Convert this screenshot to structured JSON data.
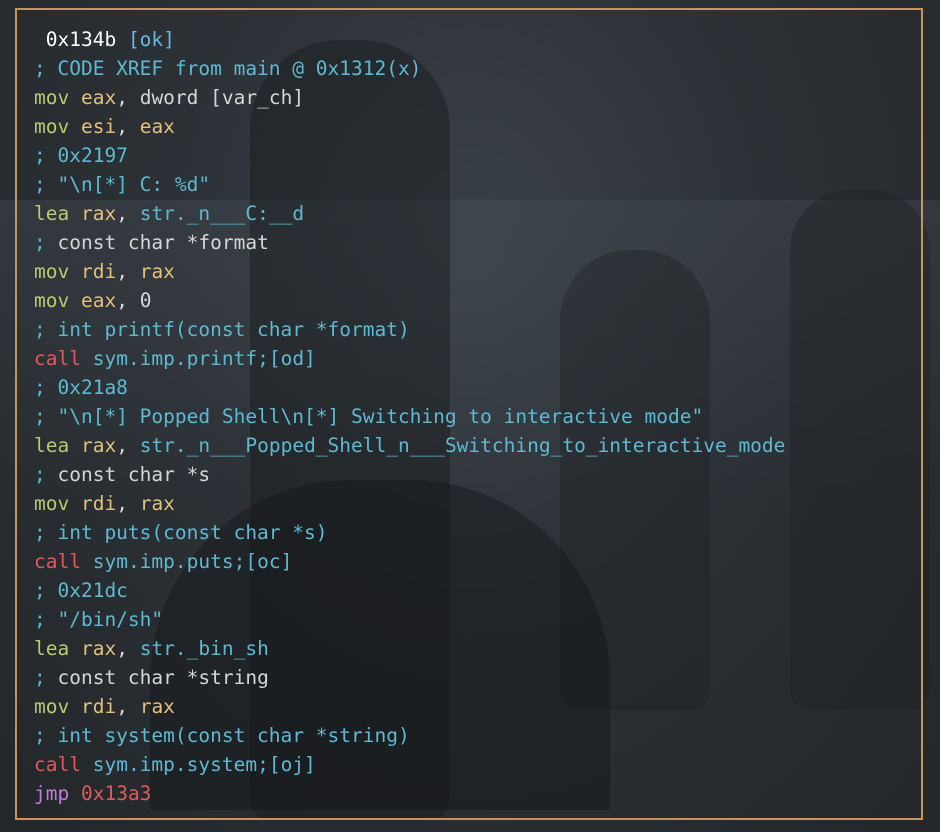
{
  "colors": {
    "border": "#c8935e",
    "comment": "#5dbad2",
    "mnemonic": "#b5cc6e",
    "register": "#e2c07a",
    "call": "#e05a5a",
    "jump": "#c678dd"
  },
  "header": {
    "address": " 0x134b",
    "status": "[ok]"
  },
  "xref": "; CODE XREF from main @ 0x1312(x)",
  "lines": {
    "l1_mn": "mov",
    "l1_reg": "eax",
    "l1_rest": ", dword [var_ch]",
    "l2_mn": "mov",
    "l2_reg": "esi",
    "l2_sep": ", ",
    "l2_reg2": "eax",
    "l3_cmt": "; 0x2197",
    "l4_cmt": "; \"\\n[*] C: %d\"",
    "l5_mn": "lea",
    "l5_reg": "rax",
    "l5_sep": ", ",
    "l5_sym": "str._n___C:__d",
    "l6_cmt_a": "; ",
    "l6_cmt_b": "const char *format",
    "l7_mn": "mov",
    "l7_reg": "rdi",
    "l7_sep": ", ",
    "l7_reg2": "rax",
    "l8_mn": "mov",
    "l8_reg": "eax",
    "l8_rest": ", 0",
    "l9_cmt": "; int printf(const char *format)",
    "l10_mn": "call",
    "l10_sym": "sym.imp.printf",
    "l10_tag": ";[od]",
    "l11_cmt": "; 0x21a8",
    "l12_cmt": "; \"\\n[*] Popped Shell\\n[*] Switching to interactive mode\"",
    "l13_mn": "lea",
    "l13_reg": "rax",
    "l13_sep": ", ",
    "l13_sym": "str._n___Popped_Shell_n___Switching_to_interactive_mode",
    "l14_cmt_a": "; ",
    "l14_cmt_b": "const char *s",
    "l15_mn": "mov",
    "l15_reg": "rdi",
    "l15_sep": ", ",
    "l15_reg2": "rax",
    "l16_cmt": "; int puts(const char *s)",
    "l17_mn": "call",
    "l17_sym": "sym.imp.puts",
    "l17_tag": ";[oc]",
    "l18_cmt": "; 0x21dc",
    "l19_cmt": "; \"/bin/sh\"",
    "l20_mn": "lea",
    "l20_reg": "rax",
    "l20_sep": ", ",
    "l20_sym": "str._bin_sh",
    "l21_cmt_a": "; ",
    "l21_cmt_b": "const char *string",
    "l22_mn": "mov",
    "l22_reg": "rdi",
    "l22_sep": ", ",
    "l22_reg2": "rax",
    "l23_cmt": "; int system(const char *string)",
    "l24_mn": "call",
    "l24_sym": "sym.imp.system",
    "l24_tag": ";[oj]",
    "l25_mn": "jmp",
    "l25_target": "0x13a3"
  }
}
